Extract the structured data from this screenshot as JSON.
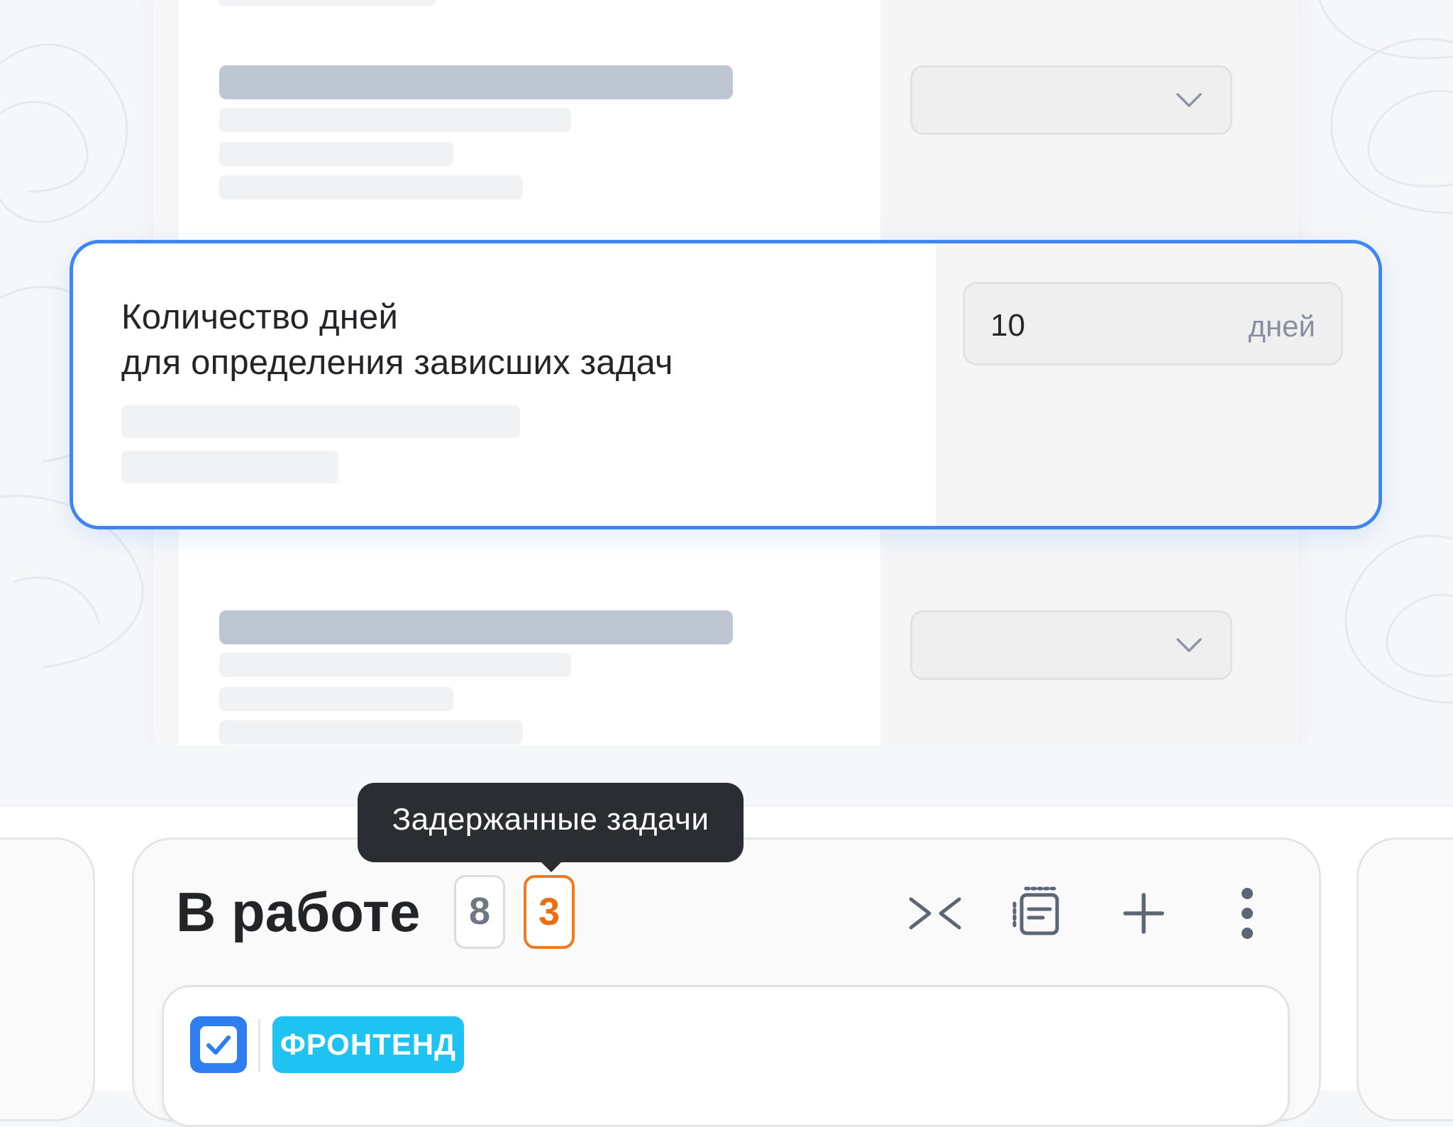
{
  "setting": {
    "title_line1": "Количество дней",
    "title_line2": "для определения зависших задач",
    "value": "10",
    "unit": "дней"
  },
  "column": {
    "title": "В работе",
    "count_total": "8",
    "count_delayed": "3",
    "tooltip": "Задержанные задачи",
    "tools": [
      "collapse-icon",
      "backlog-icon",
      "plus-icon",
      "more-vertical-icon"
    ]
  },
  "task": {
    "checked": true,
    "tag": "ФРОНТЕНД"
  },
  "colors": {
    "accent_blue": "#3f86f2",
    "delayed_orange": "#f07a22",
    "tag_cyan": "#1fc3f1",
    "tooltip_bg": "#2a2d31"
  }
}
